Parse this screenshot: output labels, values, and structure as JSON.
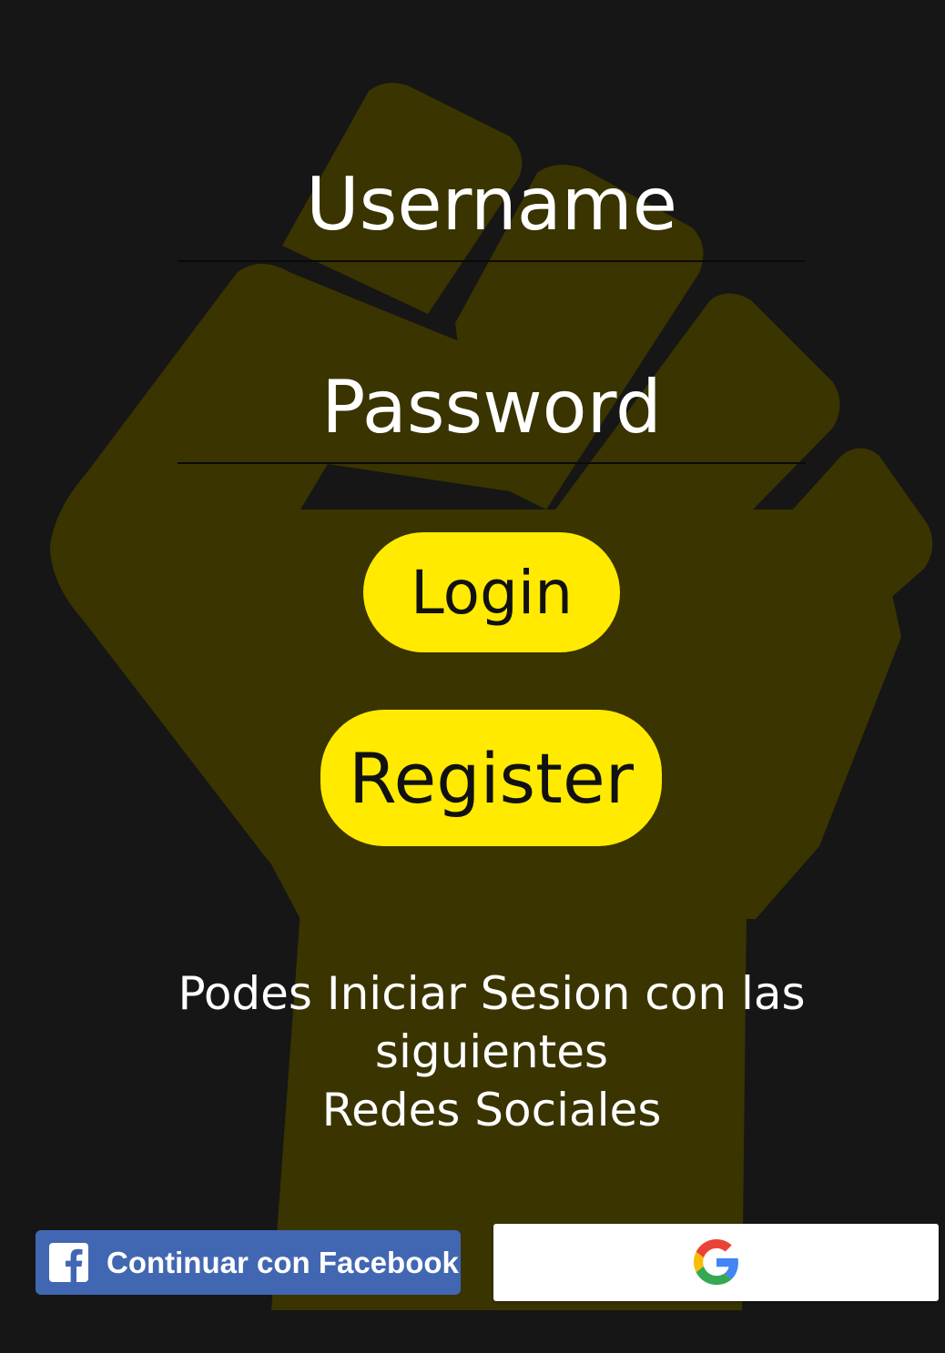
{
  "login_form": {
    "username_placeholder": "Username",
    "password_placeholder": "Password",
    "login_label": "Login",
    "register_label": "Register"
  },
  "social": {
    "info_line1": "Podes Iniciar Sesion con las siguientes",
    "info_line2": "Redes Sociales",
    "facebook_label": "Continuar con Facebook",
    "google_icon": "google-g-icon",
    "facebook_icon": "facebook-f-icon"
  },
  "theme": {
    "background": "#161616",
    "accent_yellow": "#ffea00",
    "fist_color": "#3a3400",
    "facebook_blue": "#4267b2"
  }
}
